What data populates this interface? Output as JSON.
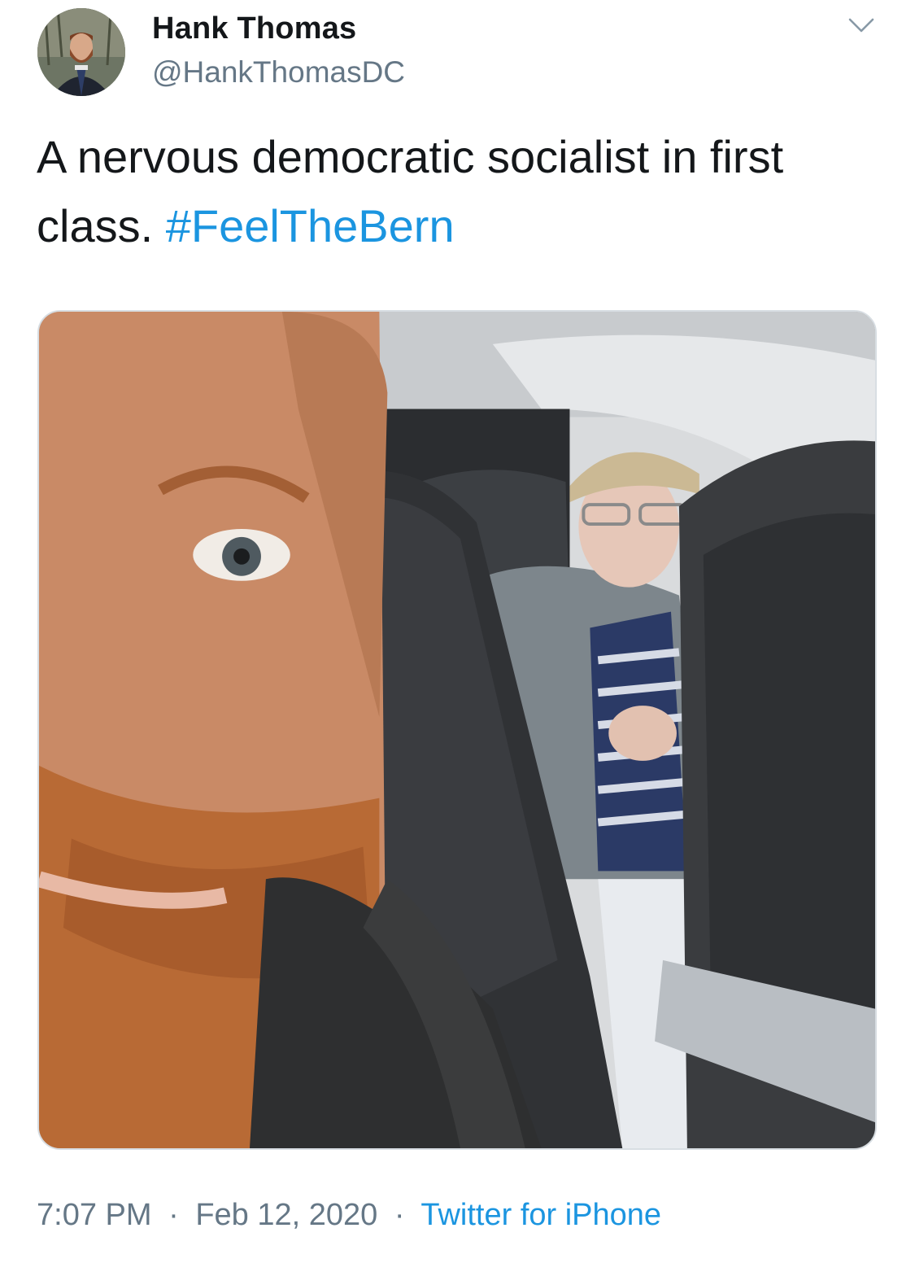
{
  "author": {
    "display_name": "Hank Thomas",
    "handle": "@HankThomasDC"
  },
  "tweet": {
    "text": "A nervous democratic socialist in first class.",
    "hashtag": "#FeelTheBern"
  },
  "meta": {
    "time": "7:07 PM",
    "separator": "·",
    "date": "Feb 12, 2020",
    "source": "Twitter for iPhone"
  },
  "colors": {
    "link": "#1b95e0",
    "secondary_text": "#657786",
    "primary_text": "#14171a"
  },
  "icons": {
    "menu": "chevron-down-icon"
  }
}
